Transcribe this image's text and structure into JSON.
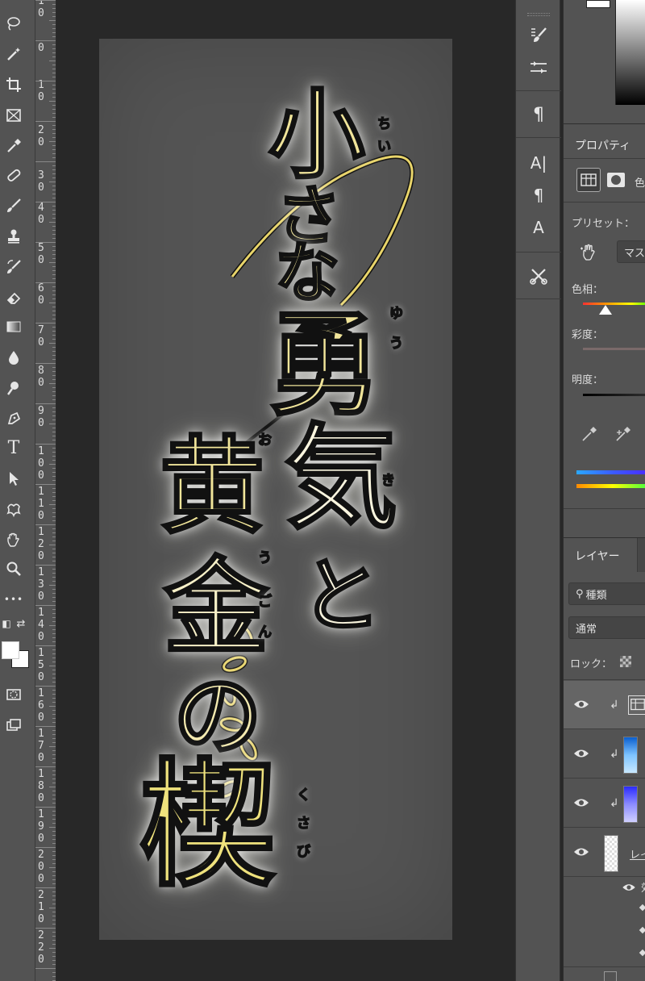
{
  "toolbar": {
    "tools": [
      {
        "icon": "lasso-icon"
      },
      {
        "icon": "magic-wand-icon"
      },
      {
        "icon": "crop-icon"
      },
      {
        "icon": "frame-icon"
      },
      {
        "icon": "eyedropper-icon"
      },
      {
        "icon": "healing-brush-icon"
      },
      {
        "icon": "brush-icon"
      },
      {
        "icon": "clone-stamp-icon"
      },
      {
        "icon": "history-brush-icon"
      },
      {
        "icon": "eraser-icon"
      },
      {
        "icon": "gradient-icon"
      },
      {
        "icon": "blur-icon"
      },
      {
        "icon": "dodge-icon"
      },
      {
        "icon": "pen-icon"
      },
      {
        "icon": "type-icon",
        "glyph": "T"
      },
      {
        "icon": "path-selection-icon"
      },
      {
        "icon": "custom-shape-icon"
      },
      {
        "icon": "hand-icon"
      },
      {
        "icon": "zoom-icon"
      },
      {
        "icon": "more-tools-icon",
        "glyph": "•••"
      }
    ]
  },
  "ruler": {
    "labels": [
      "1\n0",
      "1\n0\n0",
      "1\n1\n0",
      "1\n2\n0",
      "1\n3\n0",
      "1\n4\n0",
      "1\n5\n0",
      "1\n6\n0",
      "1\n7\n0",
      "1\n8\n0",
      "1\n9\n0",
      "2\n0\n0",
      "2\n1\n0",
      "2\n2\n0"
    ],
    "short_labels": [
      "0",
      "1\n0",
      "2\n0",
      "3\n0",
      "4\n0",
      "5\n0",
      "6\n0",
      "7\n0",
      "8\n0",
      "9\n0"
    ]
  },
  "artwork": {
    "line1": [
      "小",
      "さ",
      "な"
    ],
    "line2": [
      "勇",
      "気",
      "と"
    ],
    "line3": [
      "黄",
      "金",
      "の",
      "楔"
    ],
    "ruby_chii": [
      "ち",
      "い"
    ],
    "ruby_yuu": [
      "ゆ",
      "う"
    ],
    "ruby_o": "お",
    "ruby_ki": "き",
    "ruby_ou": "う",
    "ruby_gon": [
      "ご",
      "ん"
    ],
    "ruby_kusabi": [
      "く",
      "さ",
      "び"
    ],
    "colors": {
      "gold": "#f1e59a",
      "outline": "#111111",
      "glow": "#ffffff"
    }
  },
  "strip": {
    "icons": [
      "brush-settings-icon",
      "adjust-icon",
      "paragraph-icon",
      "character-icon",
      "paragraph-style-icon",
      "character-style-icon",
      "tools-icon"
    ],
    "paragraph": "¶",
    "character": "A|",
    "para_style": "¶",
    "char_style": "A"
  },
  "properties": {
    "title": "プロパティ",
    "tab_partial": "色",
    "preset_label": "プリセット：",
    "preset_value": "マス",
    "hue_label": "色相：",
    "saturation_label": "彩度：",
    "lightness_label": "明度："
  },
  "layers": {
    "title": "レイヤー",
    "search_value": "種類",
    "blend_mode": "通常",
    "lock_label": "ロック：",
    "layer_name_partial": "レイ",
    "sub_label": "効"
  }
}
